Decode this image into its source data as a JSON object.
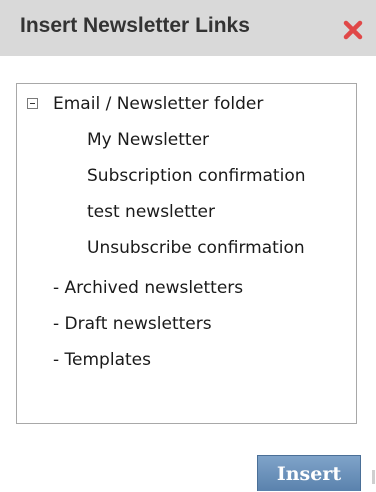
{
  "dialog": {
    "title": "Insert Newsletter Links",
    "close_icon": "close-x-icon"
  },
  "tree": {
    "root": {
      "label": "Email / Newsletter folder",
      "expanded": true,
      "toggle_icon": "collapse-minus-icon",
      "children": [
        "My Newsletter",
        "Subscription confirmation",
        "test newsletter",
        "Unsubscribe confirmation"
      ]
    },
    "folders": [
      "- Archived newsletters",
      "- Draft newsletters",
      "- Templates"
    ]
  },
  "actions": {
    "insert_label": "Insert"
  },
  "colors": {
    "titlebar": "#d9d9d9",
    "close_icon": "#e04848",
    "button": "#6b90b9",
    "border": "#a8a8a8"
  }
}
